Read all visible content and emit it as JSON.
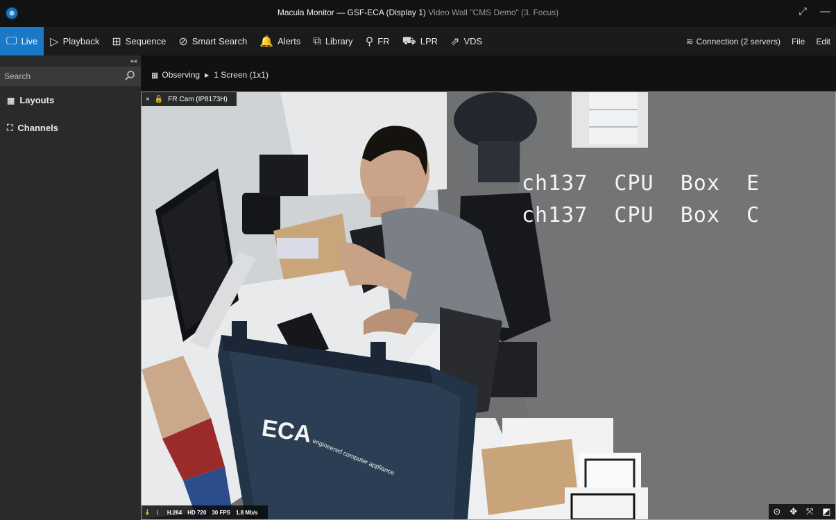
{
  "window": {
    "title_main": "Macula Monitor — GSF-ECA (Display 1)",
    "title_sub": "Video Wall \"CMS Demo\" (3. Focus)",
    "restore_glyph": "⤢",
    "minimize_glyph": "—"
  },
  "menu": {
    "items": [
      {
        "label": "Live",
        "icon": "monitor-icon",
        "glyph": "🖵"
      },
      {
        "label": "Playback",
        "icon": "play-icon",
        "glyph": "▷"
      },
      {
        "label": "Sequence",
        "icon": "sequence-icon",
        "glyph": "⊞"
      },
      {
        "label": "Smart Search",
        "icon": "smart-search-icon",
        "glyph": "⊘"
      },
      {
        "label": "Alerts",
        "icon": "bell-icon",
        "glyph": "🔔"
      },
      {
        "label": "Library",
        "icon": "library-icon",
        "glyph": "⧉"
      },
      {
        "label": "FR",
        "icon": "face-icon",
        "glyph": "⚲"
      },
      {
        "label": "LPR",
        "icon": "car-icon",
        "glyph": "⛟"
      },
      {
        "label": "VDS",
        "icon": "export-icon",
        "glyph": "⇗"
      }
    ],
    "active": "Live",
    "connection_label": "Connection (2 servers)",
    "connection_glyph": "≋",
    "file_label": "File",
    "edit_label": "Edit"
  },
  "sidebar": {
    "collapse_glyph": "◂◂",
    "search_placeholder": "Search",
    "layouts_label": "Layouts",
    "layouts_glyph": "▦",
    "channels_label": "Channels",
    "channels_glyph": "⛶"
  },
  "breadcrumb": {
    "glyph": "▦",
    "observing": "Observing",
    "separator": "▶",
    "screen": "1 Screen (1x1)"
  },
  "tile": {
    "close_glyph": "×",
    "lock_glyph": "🔓",
    "camera_name": "FR Cam (IP8173H)",
    "overlay_line1": "ch137  CPU  Box  E",
    "overlay_line2": "ch137  CPU  Box  C",
    "case_brand": "ECA",
    "case_tagline": "engineered computer appliance",
    "status": {
      "download_glyph": "⤓",
      "person_glyph": "🚶",
      "codec": "H.264",
      "resolution": "HD 720",
      "fps": "30 FPS",
      "bitrate": "1.8 Mb/s"
    },
    "tools": [
      "⊙",
      "✥",
      "⤧",
      "◩"
    ]
  },
  "colors": {
    "accent": "#1a78c9",
    "tile_border": "#c9a227"
  }
}
